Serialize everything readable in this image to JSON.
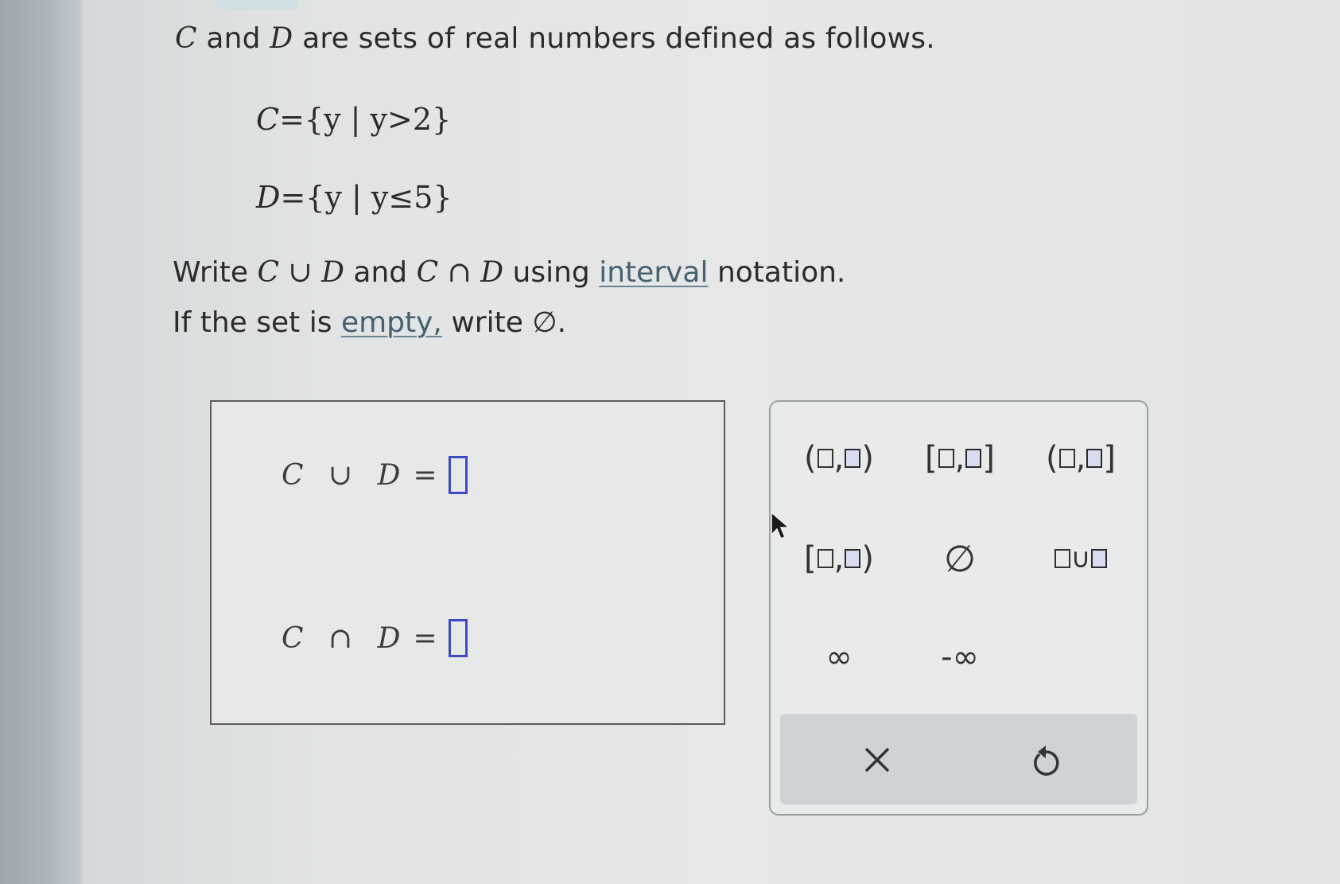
{
  "problem": {
    "intro_var1": "C",
    "intro_mid": "and",
    "intro_var2": "D",
    "intro_rest": "are sets of real numbers defined as follows.",
    "set_c_lhs": "C",
    "set_c_rhs": "={y | y>2}",
    "set_d_lhs": "D",
    "set_d_rhs": "={y | y≤5}",
    "instr_write": "Write",
    "instr_union_expr": "C ∪ D",
    "instr_and": "and",
    "instr_inter_expr": "C ∩ D",
    "instr_using": "using",
    "instr_link_interval": "interval",
    "instr_notation": "notation.",
    "instr2_prefix": "If the set is",
    "instr2_link_empty": "empty,",
    "instr2_suffix": "write ∅."
  },
  "answers": {
    "union_label": "C ∪ D",
    "intersection_label": "C ∩ D",
    "equals": "="
  },
  "keypad": {
    "open_open": {
      "left": "(",
      "comma": ",",
      "right": ")"
    },
    "closed_closed": {
      "left": "[",
      "comma": ",",
      "right": "]"
    },
    "open_closed": {
      "left": "(",
      "comma": ",",
      "right": "]"
    },
    "closed_open": {
      "left": "[",
      "comma": ",",
      "right": ")"
    },
    "empty_set": "∅",
    "union_sym": "∪",
    "infinity": "∞",
    "neg_infinity": "-∞",
    "clear_icon": "x-icon",
    "undo_icon": "undo-icon"
  },
  "colors": {
    "answer_box_border": "#3b4bc4",
    "link": "#45606f",
    "action_bar": "#cfd3d5"
  }
}
